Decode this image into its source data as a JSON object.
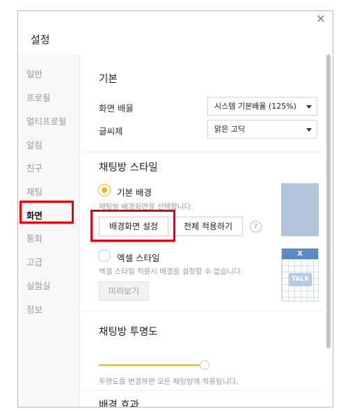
{
  "window": {
    "title": "설정",
    "close_icon": "×"
  },
  "sidebar": {
    "items": [
      {
        "label": "일반"
      },
      {
        "label": "프로필"
      },
      {
        "label": "멀티프로필"
      },
      {
        "label": "알림"
      },
      {
        "label": "친구"
      },
      {
        "label": "채팅"
      },
      {
        "label": "화면",
        "active": true
      },
      {
        "label": "통화"
      },
      {
        "label": "고급"
      },
      {
        "label": "실험실"
      },
      {
        "label": "정보"
      }
    ]
  },
  "basic": {
    "heading": "기본",
    "screen_scale": {
      "label": "화면 배율",
      "value": "시스템 기본배율 (125%)"
    },
    "font": {
      "label": "글씨체",
      "value": "맑은 고딕"
    }
  },
  "chat_style": {
    "heading": "채팅방 스타일",
    "basic_bg": {
      "label": "기본 배경",
      "selected": true,
      "description": "채팅방 배경화면을 선택합니다.",
      "set_button": "배경화면 설정",
      "apply_all_button": "전체 적용하기",
      "help_icon": "?"
    },
    "excel_style": {
      "label": "엑셀 스타일",
      "selected": false,
      "description": "엑셀 스타일 적용시 배경을 설정할 수 없습니다.",
      "preview_button": "미리보기",
      "preview_badge": "X",
      "preview_talk": "TALK"
    }
  },
  "transparency": {
    "heading": "채팅방 투명도",
    "level": 1.0,
    "description": "투명도를 변경하면 모든 채팅방에 적용됩니다."
  },
  "background_effect": {
    "heading": "배경 효과"
  },
  "colors": {
    "accent": "#f5b800",
    "highlight": "#e8000b",
    "preview_blue": "#b3c5dc"
  }
}
